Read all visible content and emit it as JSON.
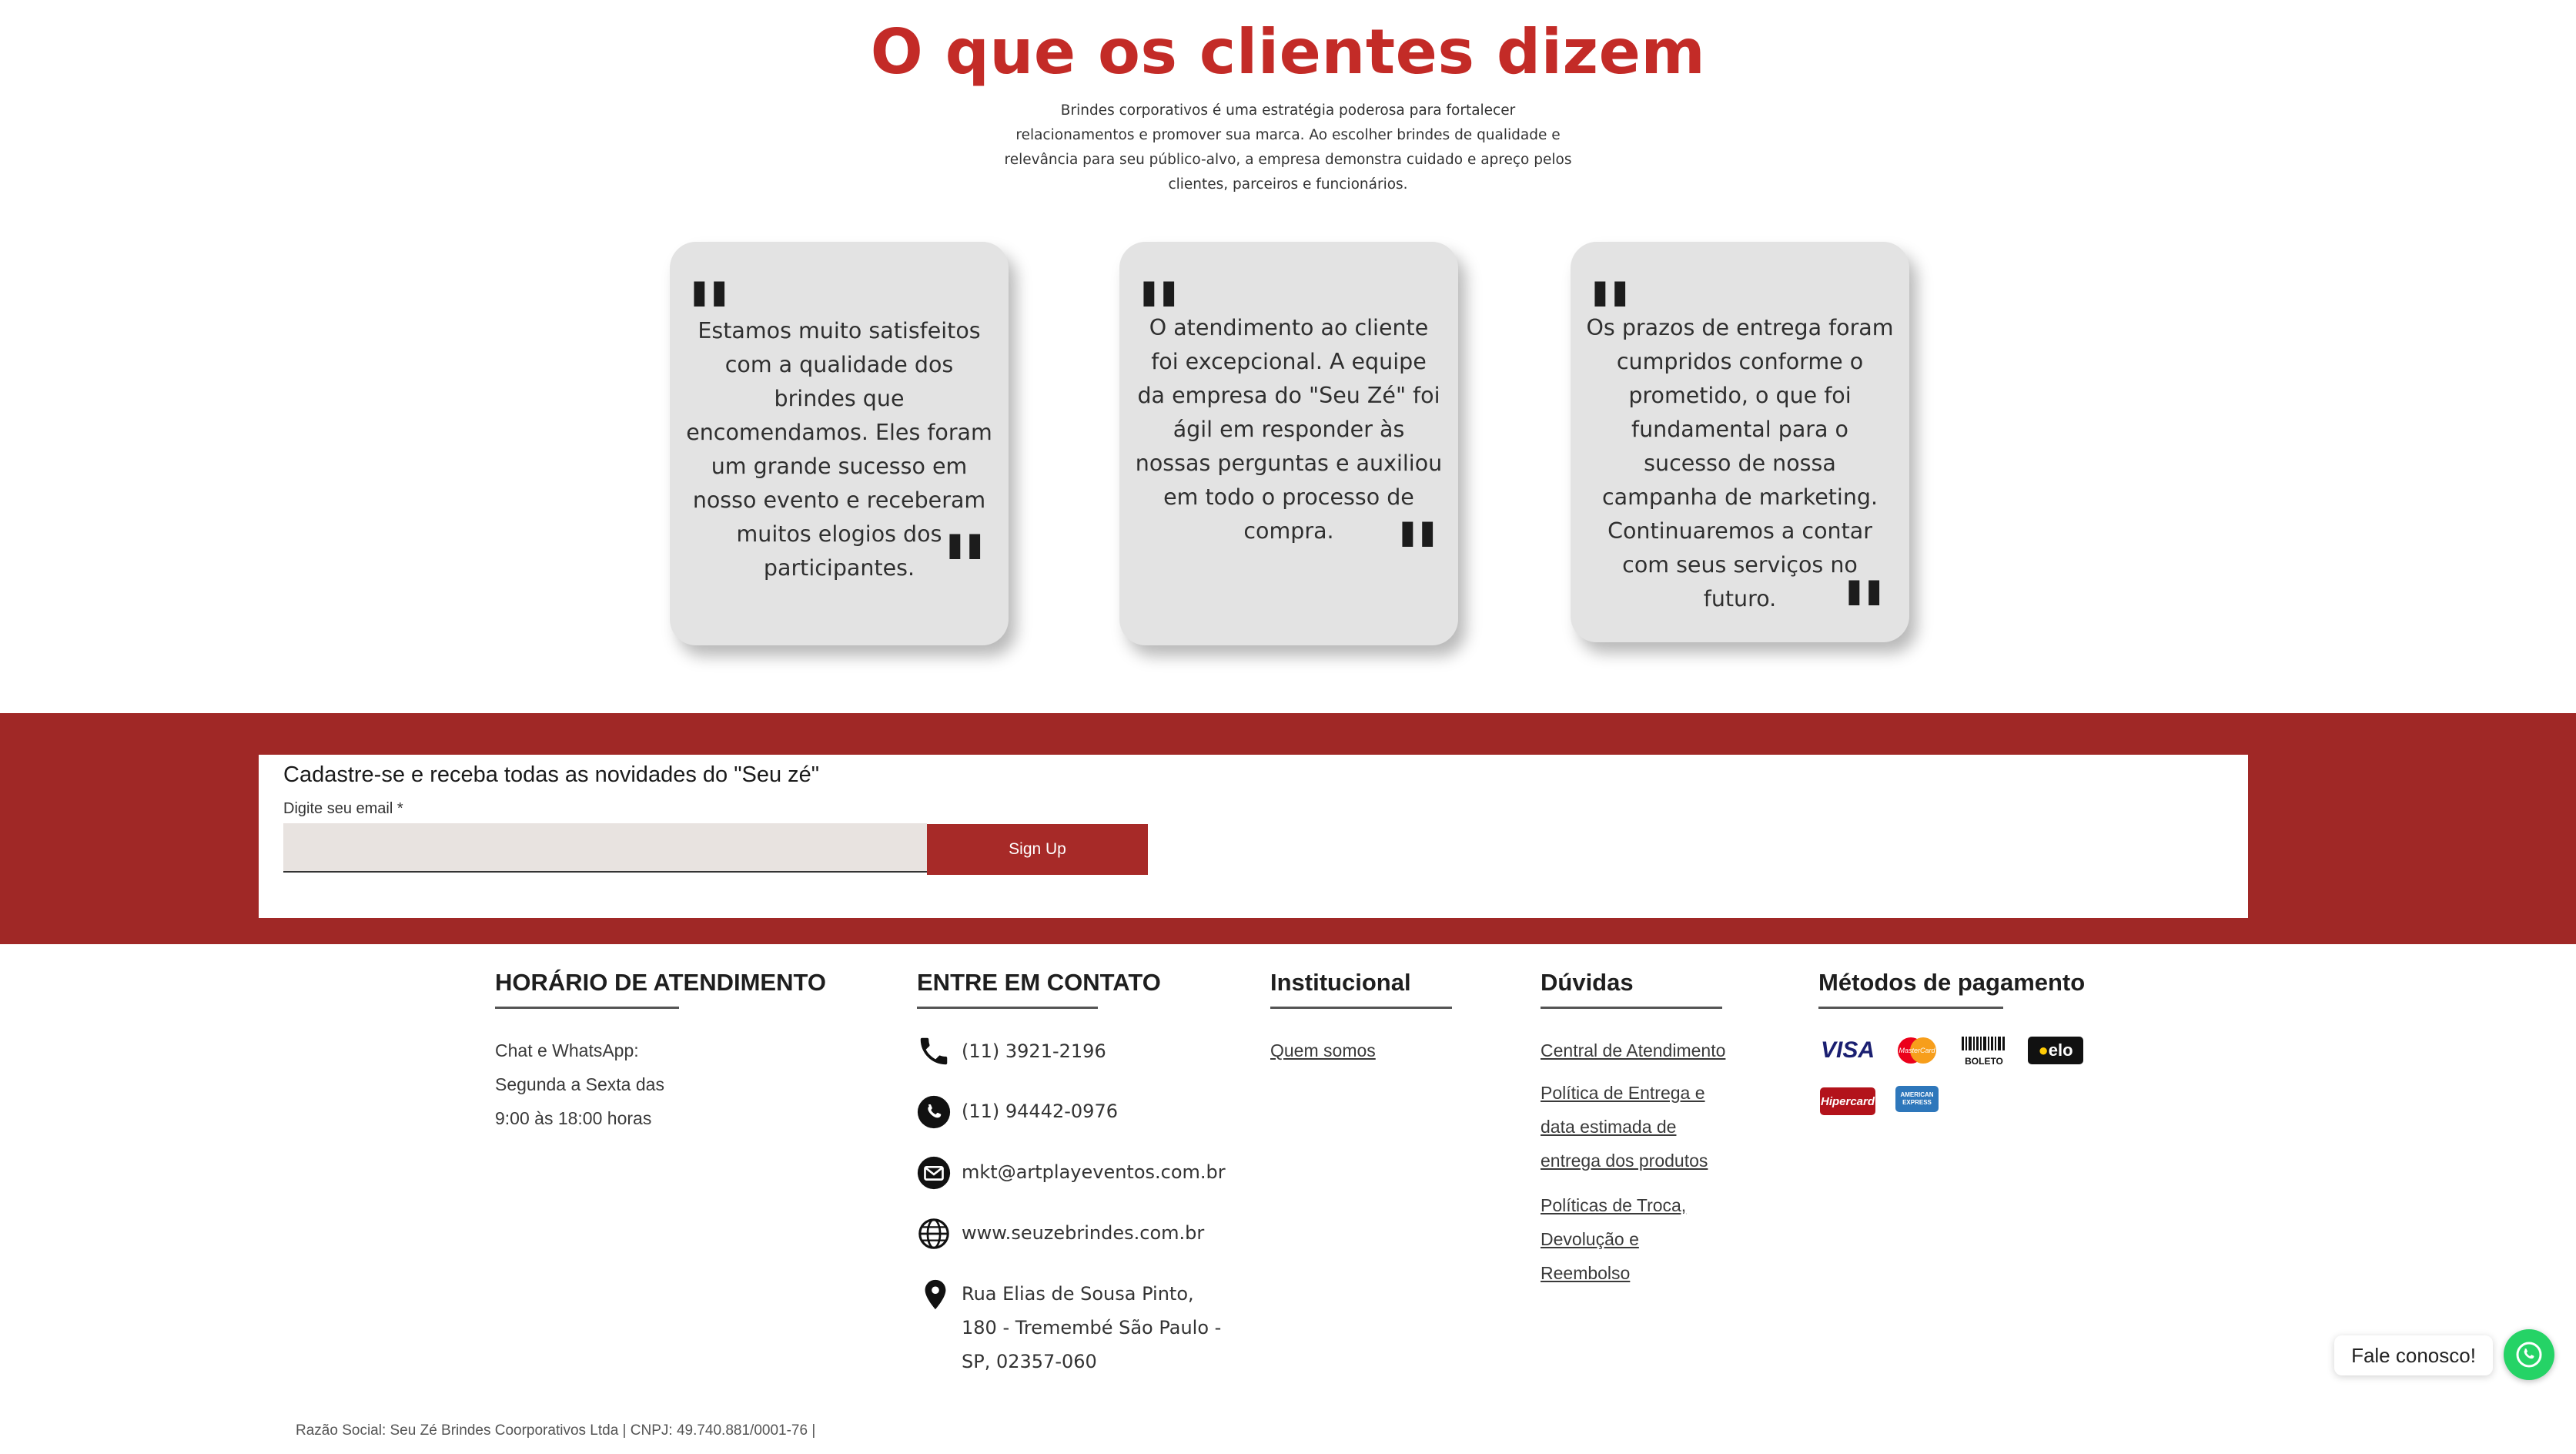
{
  "testimonials": {
    "title": "O que os clientes dizem",
    "intro": "Brindes corporativos é uma estratégia poderosa para fortalecer relacionamentos e promover sua marca. Ao escolher brindes de qualidade e relevância para seu público-alvo, a empresa demonstra cuidado e apreço pelos clientes, parceiros e funcionários.",
    "cards": [
      {
        "text": "Estamos muito satisfeitos com a qualidade dos brindes que encomendamos. Eles foram um grande sucesso em nosso evento e receberam muitos elogios dos participantes."
      },
      {
        "text": "O atendimento ao cliente foi excepcional. A equipe da empresa do \"Seu Zé\" foi ágil em responder às nossas perguntas e auxiliou em todo o processo de compra."
      },
      {
        "text": "Os prazos de entrega foram cumpridos conforme o prometido, o que foi fundamental para o sucesso de nossa campanha de marketing. Continuaremos a contar com seus serviços no futuro."
      }
    ]
  },
  "newsletter": {
    "title": "Cadastre-se e receba todas as novidades do \"Seu zé\"",
    "email_label": "Digite seu email *",
    "email_value": "",
    "button_label": "Sign Up"
  },
  "footer": {
    "hours": {
      "title": "HORÁRIO DE ATENDIMENTO",
      "lines": [
        "Chat e WhatsApp:",
        "Segunda a Sexta das",
        "9:00 às 18:00 horas"
      ]
    },
    "contact": {
      "title": "ENTRE EM CONTATO",
      "phone": "(11) 3921-2196",
      "whatsapp": "(11) 94442-0976",
      "email": "mkt@artplayeventos.com.br",
      "website": "www.seuzebrindes.com.br",
      "address_lines": [
        "Rua Elias de Sousa Pinto,",
        "180 - Tremembé São Paulo -",
        "SP, 02357-060"
      ]
    },
    "institutional": {
      "title": "Institucional",
      "links": [
        "Quem somos"
      ]
    },
    "faq": {
      "title": "Dúvidas",
      "link1": "Central de Atendimento",
      "link2_lines": [
        "Política de Entrega e",
        "data estimada de",
        "entrega dos produtos"
      ],
      "link3_lines": [
        "Políticas de Troca,",
        "Devolução e",
        "Reembolso"
      ]
    },
    "payment": {
      "title": "Métodos de pagamento",
      "methods": [
        "VISA",
        "MasterCard",
        "BOLETO",
        "elo",
        "Hipercard",
        "AMERICAN EXPRESS"
      ]
    },
    "legal": "Razão Social: Seu Zé Brindes Coorporativos Ltda | CNPJ: 49.740.881/0001-76 |"
  },
  "chat": {
    "label": "Fale conosco!"
  },
  "colors": {
    "brand_red": "#a02826",
    "title_red": "#c32b27",
    "whatsapp_green": "#25d366"
  }
}
